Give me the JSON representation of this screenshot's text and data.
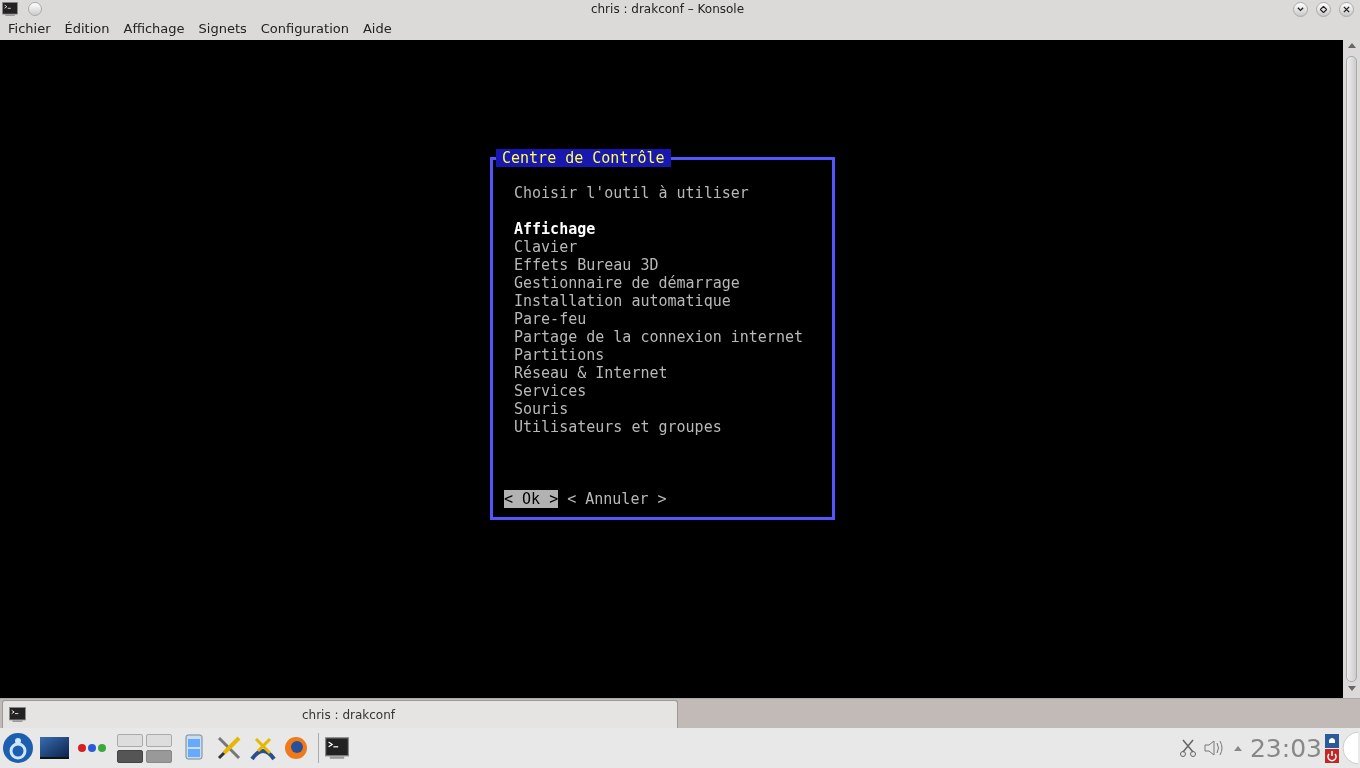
{
  "window": {
    "title": "chris : drakconf – Konsole"
  },
  "menu_bar": [
    "Fichier",
    "Édition",
    "Affichage",
    "Signets",
    "Configuration",
    "Aide"
  ],
  "dialog": {
    "title": "Centre de Contrôle",
    "prompt": "Choisir l'outil à utiliser",
    "items": [
      {
        "label": "Affichage",
        "selected": true
      },
      {
        "label": "Clavier",
        "selected": false
      },
      {
        "label": "Effets Bureau 3D",
        "selected": false
      },
      {
        "label": "Gestionnaire de démarrage",
        "selected": false
      },
      {
        "label": "Installation automatique",
        "selected": false
      },
      {
        "label": "Pare-feu",
        "selected": false
      },
      {
        "label": "Partage de la connexion internet",
        "selected": false
      },
      {
        "label": "Partitions",
        "selected": false
      },
      {
        "label": "Réseau & Internet",
        "selected": false
      },
      {
        "label": "Services",
        "selected": false
      },
      {
        "label": "Souris",
        "selected": false
      },
      {
        "label": "Utilisateurs et groupes",
        "selected": false
      }
    ],
    "buttons": [
      {
        "label": "< Ok >",
        "selected": true
      },
      {
        "label": "< Annuler >",
        "selected": false
      }
    ]
  },
  "tab_bar": {
    "tabs": [
      {
        "label": "chris : drakconf",
        "selected": true
      }
    ]
  },
  "panel": {
    "clock": "23:03"
  }
}
